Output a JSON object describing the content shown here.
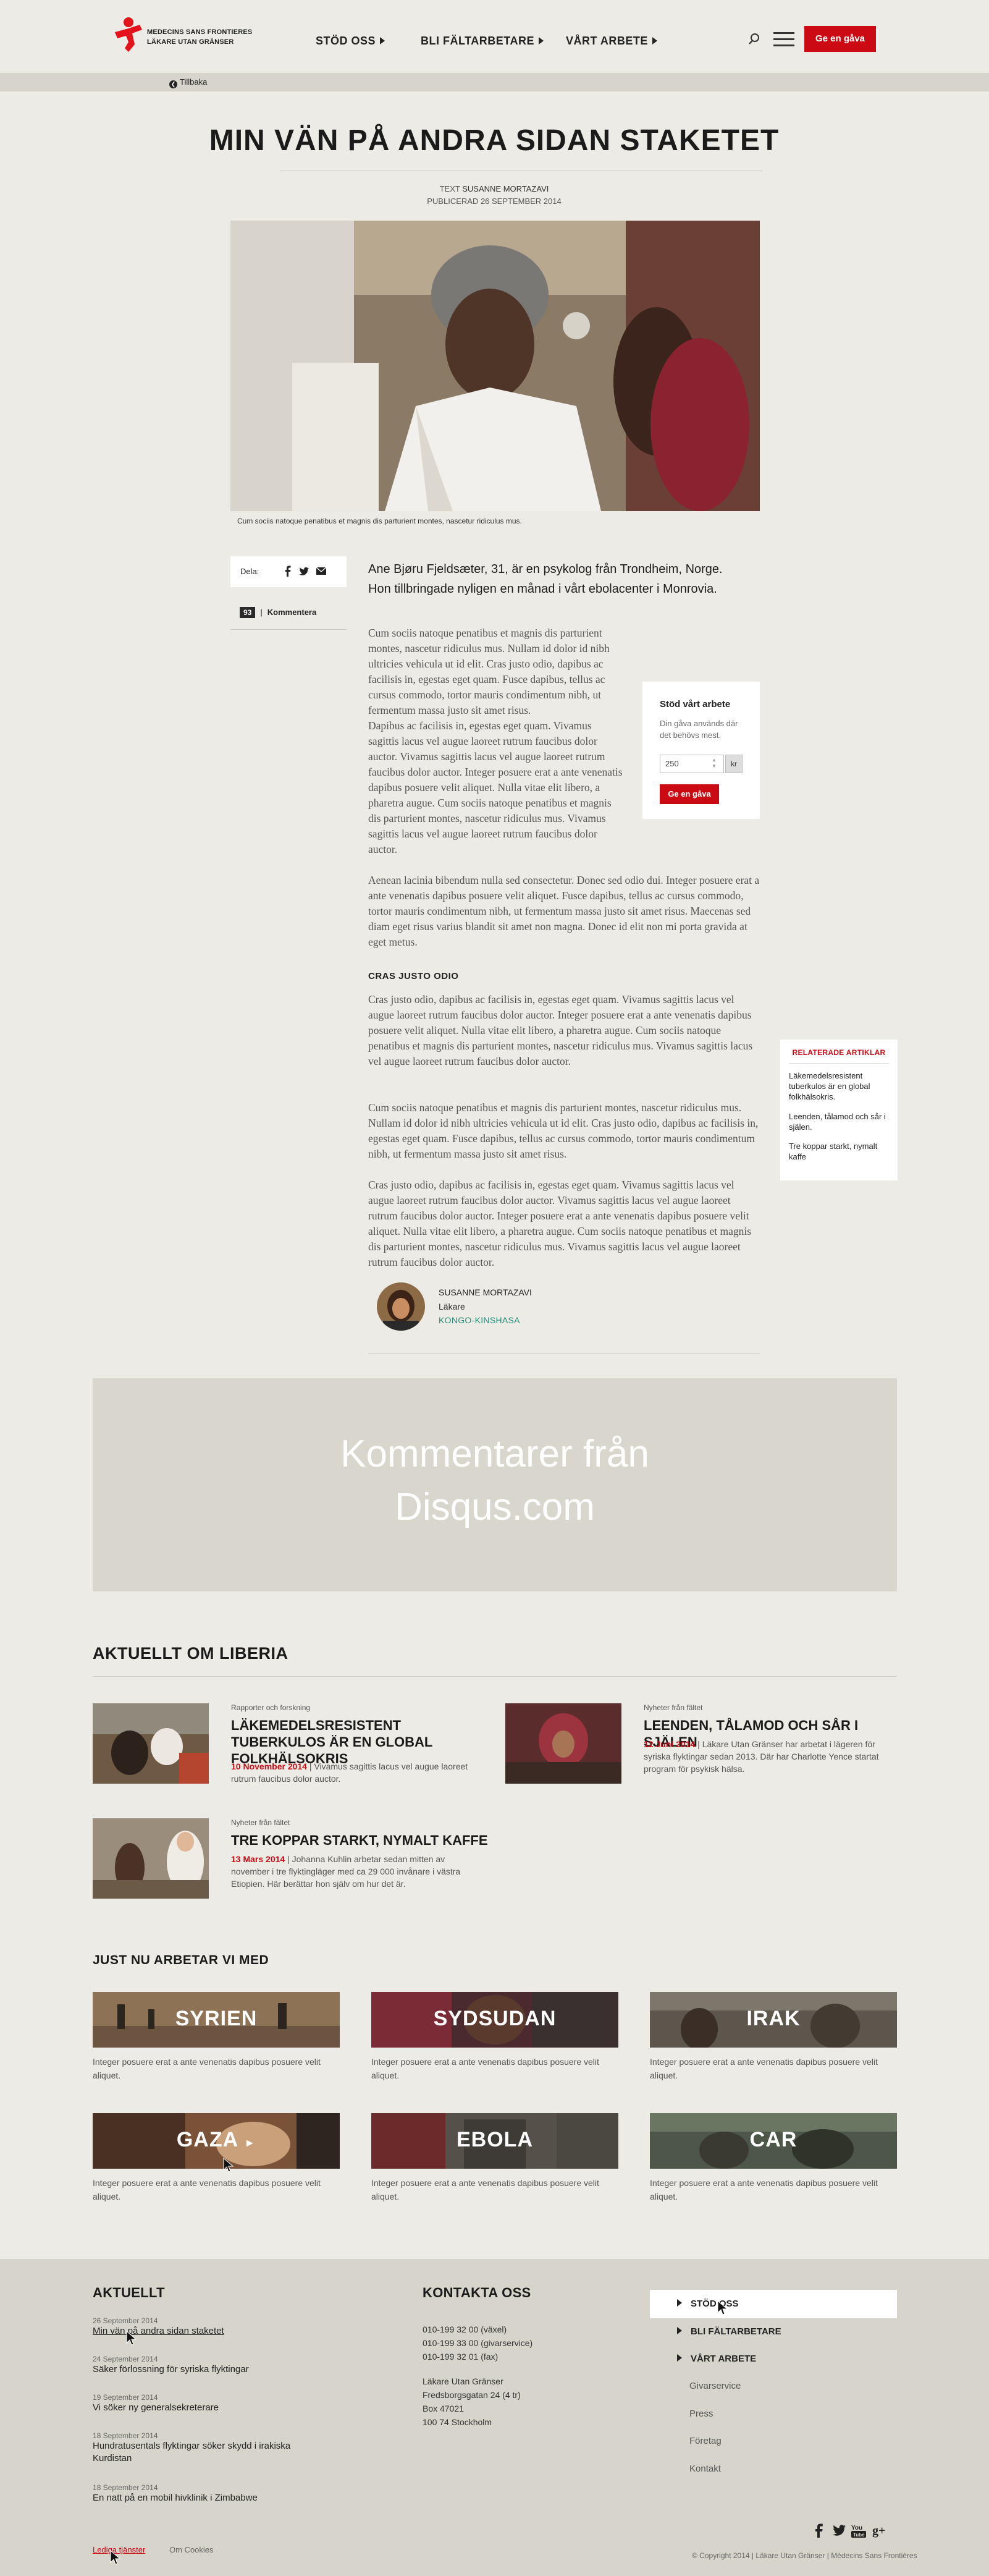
{
  "header": {
    "logo_line1": "MEDECINS SANS FRONTIERES",
    "logo_line2": "LÄKARE UTAN GRÄNSER",
    "nav": [
      "STÖD OSS",
      "BLI FÄLTARBETARE",
      "VÅRT ARBETE"
    ],
    "give_button": "Ge en gåva",
    "back_link": "Tillbaka"
  },
  "article": {
    "title": "MIN VÄN PÅ ANDRA SIDAN STAKETET",
    "byline_prefix": "TEXT",
    "author_upper": "SUSANNE MORTAZAVI",
    "published": "PUBLICERAD 26 SEPTEMBER 2014",
    "image_caption": "Cum sociis natoque penatibus et magnis dis parturient montes, nascetur ridiculus mus.",
    "share_label": "Dela:",
    "comment_count": "93",
    "comment_label": "Kommentera",
    "lead": "Ane Bjøru Fjeldsæter, 31, är en psykolog från Trondheim, Norge. Hon tillbringade nyligen en månad i vårt ebolacenter i Monrovia.",
    "p1": "Cum sociis natoque penatibus et magnis dis parturient montes, nascetur ridiculus mus. Nullam id dolor id nibh ultricies vehicula ut id elit. Cras justo odio, dapibus ac facilisis in, egestas eget quam. Fusce dapibus, tellus ac cursus commodo, tortor mauris condimentum nibh, ut fermentum massa justo sit amet risus.",
    "p2": "Dapibus ac facilisis in, egestas eget quam. Vivamus sagittis lacus vel augue laoreet rutrum faucibus dolor auctor. Vivamus sagittis lacus vel augue laoreet rutrum faucibus dolor auctor. Integer posuere erat a ante venenatis dapibus posuere velit aliquet. Nulla vitae elit libero, a pharetra augue. Cum sociis natoque penatibus et magnis dis parturient montes, nascetur ridiculus mus. Vivamus sagittis lacus vel augue laoreet rutrum faucibus dolor auctor.",
    "p3": "Aenean lacinia bibendum nulla sed consectetur. Donec sed odio dui. Integer posuere erat a ante venenatis dapibus posuere velit aliquet. Fusce dapibus, tellus ac cursus commodo, tortor mauris condimentum nibh, ut fermentum massa justo sit amet risus. Maecenas sed diam eget risus varius blandit sit amet non magna. Donec id elit non mi porta gravida at eget metus.",
    "subhead": "CRAS JUSTO ODIO",
    "p4": "Cras justo odio, dapibus ac facilisis in, egestas eget quam. Vivamus sagittis lacus vel augue laoreet rutrum faucibus dolor auctor. Integer posuere erat a ante venenatis dapibus posuere velit aliquet. Nulla vitae elit libero, a pharetra augue. Cum sociis natoque penatibus et magnis dis parturient montes, nascetur ridiculus mus. Vivamus sagittis lacus vel augue laoreet rutrum faucibus dolor auctor.",
    "p5": "Cum sociis natoque penatibus et magnis dis parturient montes, nascetur ridiculus mus. Nullam id dolor id nibh ultricies vehicula ut id elit. Cras justo odio, dapibus ac facilisis in, egestas eget quam. Fusce dapibus, tellus ac cursus commodo, tortor mauris condimentum nibh, ut fermentum massa justo sit amet risus.",
    "p6": "Cras justo odio, dapibus ac facilisis in, egestas eget quam. Vivamus sagittis lacus vel augue laoreet rutrum faucibus dolor auctor. Vivamus sagittis lacus vel augue laoreet rutrum faucibus dolor auctor. Integer posuere erat a ante venenatis dapibus posuere velit aliquet. Nulla vitae elit libero, a pharetra augue. Cum sociis natoque penatibus et magnis dis parturient montes, nascetur ridiculus mus. Vivamus sagittis lacus vel augue laoreet rutrum faucibus dolor auctor.",
    "author_name": "SUSANNE MORTAZAVI",
    "author_role": "Läkare",
    "author_location": "KONGO-KINSHASA"
  },
  "support_box": {
    "title": "Stöd vårt arbete",
    "text": "Din gåva används där det behövs mest.",
    "amount": "250",
    "currency": "kr",
    "button": "Ge en gåva"
  },
  "related": {
    "title": "RELATERADE ARTIKLAR",
    "items": [
      "Läkemedelsresistent tuberkulos är en global folkhälsokris.",
      "Leenden, tålamod och sår i själen.",
      "Tre koppar starkt, nymalt kaffe"
    ]
  },
  "disqus": {
    "text": "Kommentarer från Disqus.com"
  },
  "aktuellt": {
    "title": "AKTUELLT OM LIBERIA",
    "items": [
      {
        "category": "Rapporter och forskning",
        "title": "LÄKEMEDELSRESISTENT TUBERKULOS ÄR EN GLOBAL FOLKHÄLSOKRIS",
        "date": "10 November 2014",
        "text": "Vivamus sagittis lacus vel augue laoreet rutrum faucibus dolor auctor."
      },
      {
        "category": "Nyheter från fältet",
        "title": "LEENDEN, TÅLAMOD OCH SÅR I SJÄLEN",
        "date": "12 Juni 2014",
        "text": "Läkare Utan Gränser har arbetat i lägeren för syriska flyktingar sedan 2013. Där har Charlotte Yence startat program för psykisk hälsa."
      },
      {
        "category": "Nyheter från fältet",
        "title": "TRE KOPPAR STARKT, NYMALT KAFFE",
        "date": "13 Mars 2014",
        "text": "Johanna Kuhlin arbetar sedan mitten av november i tre flyktingläger med ca 29 000 invånare i västra Etiopien. Här berättar hon själv om hur det är."
      }
    ]
  },
  "projects": {
    "title": "JUST NU ARBETAR VI MED",
    "items": [
      {
        "label": "SYRIEN",
        "text": "Integer posuere erat a ante venenatis dapibus posuere velit aliquet."
      },
      {
        "label": "SYDSUDAN",
        "text": "Integer posuere erat a ante venenatis dapibus posuere velit aliquet."
      },
      {
        "label": "IRAK",
        "text": "Integer posuere erat a ante venenatis dapibus posuere velit aliquet."
      },
      {
        "label": "GAZA",
        "text": "Integer posuere erat a ante venenatis dapibus posuere velit aliquet."
      },
      {
        "label": "EBOLA",
        "text": "Integer posuere erat a ante venenatis dapibus posuere velit aliquet."
      },
      {
        "label": "CAR",
        "text": "Integer posuere erat a ante venenatis dapibus posuere velit aliquet."
      }
    ]
  },
  "footer": {
    "news_title": "AKTUELLT",
    "news": [
      {
        "date": "26 September 2014",
        "title": "Min vän på andra sidan staketet"
      },
      {
        "date": "24 September 2014",
        "title": "Säker förlossning för syriska flyktingar"
      },
      {
        "date": "19 September 2014",
        "title": "Vi söker ny generalsekreterare"
      },
      {
        "date": "18 September 2014",
        "title": "Hundratusentals flyktingar söker skydd i irakiska Kurdistan"
      },
      {
        "date": "18 September 2014",
        "title": "En natt på en mobil hivklinik i Zimbabwe"
      }
    ],
    "contact_title": "KONTAKTA OSS",
    "phones": [
      "010-199 32 00 (växel)",
      "010-199 33 00 (givarservice)",
      "010-199 32 01 (fax)"
    ],
    "address": [
      "Läkare Utan Gränser",
      "Fredsborgsgatan 24 (4 tr)",
      "Box 47021",
      "100 74 Stockholm"
    ],
    "menu_bold": [
      "STÖD OSS",
      "BLI FÄLTARBETARE",
      "VÅRT ARBETE"
    ],
    "menu_plain": [
      "Givarservice",
      "Press",
      "Företag",
      "Kontakt"
    ],
    "copyright": "© Copyright 2014 | Läkare Utan Gränser | Médecins Sans Frontières",
    "legal_links": [
      "Lediga tjänster",
      "Om Cookies"
    ]
  },
  "colors": {
    "brand_red": "#cc0a14",
    "background": "#ecebe6",
    "footer": "#d6d4cb",
    "location_teal": "#2a8a7a"
  }
}
